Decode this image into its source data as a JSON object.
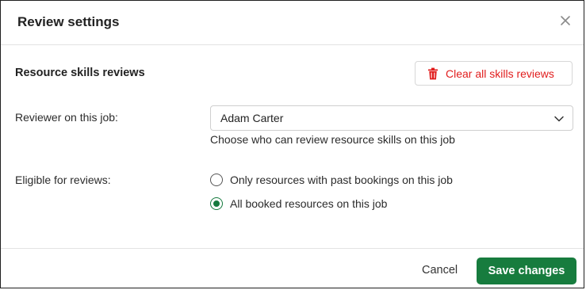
{
  "dialog": {
    "title": "Review settings",
    "close_icon": "close-icon"
  },
  "section": {
    "heading": "Resource skills reviews",
    "clear_button_label": "Clear all skills reviews",
    "clear_button_icon": "trash-icon",
    "clear_button_color": "#e11d1d"
  },
  "reviewer": {
    "label": "Reviewer on this job:",
    "selected_value": "Adam Carter",
    "dropdown_icon": "chevron-down-icon",
    "helper_text": "Choose who can review resource skills on this job"
  },
  "eligibility": {
    "label": "Eligible for reviews:",
    "options": [
      {
        "label": "Only resources with past bookings on this job",
        "checked": false
      },
      {
        "label": "All booked resources on this job",
        "checked": true
      }
    ]
  },
  "footer": {
    "cancel_label": "Cancel",
    "save_label": "Save changes",
    "save_color": "#177c3e"
  }
}
